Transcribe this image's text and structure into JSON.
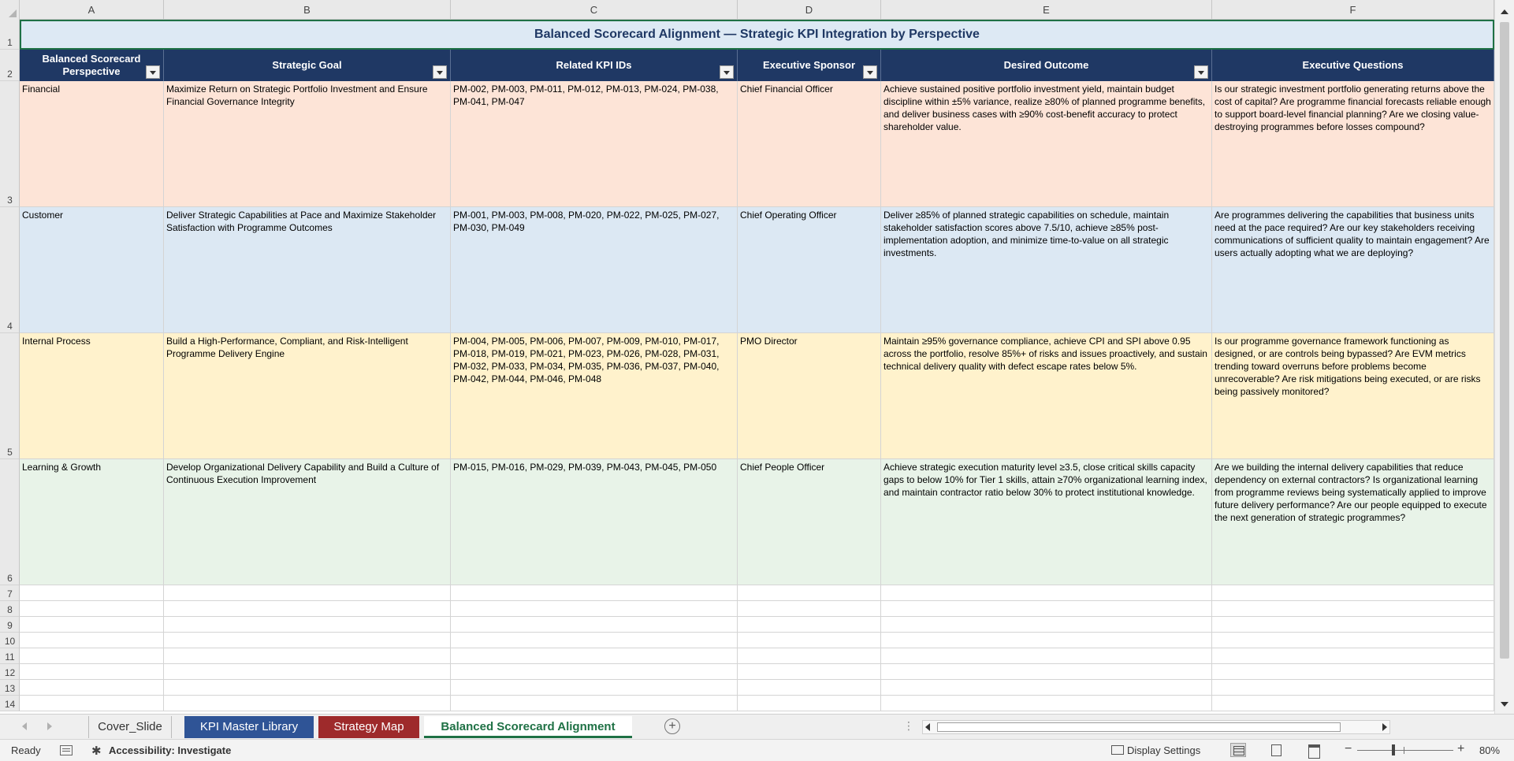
{
  "columns": [
    "A",
    "B",
    "C",
    "D",
    "E",
    "F"
  ],
  "rows": [
    "1",
    "2",
    "3",
    "4",
    "5",
    "6",
    "7",
    "8",
    "9",
    "10",
    "11",
    "12",
    "13",
    "14"
  ],
  "title": "Balanced Scorecard Alignment — Strategic KPI Integration by Perspective",
  "headers": [
    "Balanced Scorecard Perspective",
    "Strategic Goal",
    "Related KPI IDs",
    "Executive Sponsor",
    "Desired Outcome",
    "Executive Questions"
  ],
  "data": [
    {
      "perspective": "Financial",
      "goal": "Maximize Return on Strategic Portfolio Investment and Ensure Financial Governance Integrity",
      "kpis": "PM-002, PM-003, PM-011, PM-012, PM-013, PM-024, PM-038, PM-041, PM-047",
      "sponsor": "Chief Financial Officer",
      "outcome": "Achieve sustained positive portfolio investment yield, maintain budget discipline within ±5% variance, realize ≥80% of planned programme benefits, and deliver business cases with ≥90% cost-benefit accuracy to protect shareholder value.",
      "questions": "Is our strategic investment portfolio generating returns above the cost of capital? Are programme financial forecasts reliable enough to support board-level financial planning? Are we closing value-destroying programmes before losses compound?"
    },
    {
      "perspective": "Customer",
      "goal": "Deliver Strategic Capabilities at Pace and Maximize Stakeholder Satisfaction with Programme Outcomes",
      "kpis": "PM-001, PM-003, PM-008, PM-020, PM-022, PM-025, PM-027, PM-030, PM-049",
      "sponsor": "Chief Operating Officer",
      "outcome": "Deliver ≥85% of planned strategic capabilities on schedule, maintain stakeholder satisfaction scores above 7.5/10, achieve ≥85% post-implementation adoption, and minimize time-to-value on all strategic investments.",
      "questions": "Are programmes delivering the capabilities that business units need at the pace required? Are our key stakeholders receiving communications of sufficient quality to maintain engagement? Are users actually adopting what we are deploying?"
    },
    {
      "perspective": "Internal Process",
      "goal": "Build a High-Performance, Compliant, and Risk-Intelligent Programme Delivery Engine",
      "kpis": "PM-004, PM-005, PM-006, PM-007, PM-009, PM-010, PM-017, PM-018, PM-019, PM-021, PM-023, PM-026, PM-028, PM-031, PM-032, PM-033, PM-034, PM-035, PM-036, PM-037, PM-040, PM-042, PM-044, PM-046, PM-048",
      "sponsor": "PMO Director",
      "outcome": "Maintain ≥95% governance compliance, achieve CPI and SPI above 0.95 across the portfolio, resolve 85%+ of risks and issues proactively, and sustain technical delivery quality with defect escape rates below 5%.",
      "questions": "Is our programme governance framework functioning as designed, or are controls being bypassed? Are EVM metrics trending toward overruns before problems become unrecoverable? Are risk mitigations being executed, or are risks being passively monitored?"
    },
    {
      "perspective": "Learning & Growth",
      "goal": "Develop Organizational Delivery Capability and Build a Culture of Continuous Execution Improvement",
      "kpis": "PM-015, PM-016, PM-029, PM-039, PM-043, PM-045, PM-050",
      "sponsor": "Chief People Officer",
      "outcome": "Achieve strategic execution maturity level ≥3.5, close critical skills capacity gaps to below 10% for Tier 1 skills, attain ≥70% organizational learning index, and maintain contractor ratio below 30% to protect institutional knowledge.",
      "questions": "Are we building the internal delivery capabilities that reduce dependency on external contractors? Is organizational learning from programme reviews being systematically applied to improve future delivery performance? Are our people equipped to execute the next generation of strategic programmes?"
    }
  ],
  "tabs": [
    "Cover_Slide",
    "KPI Master Library",
    "Strategy Map",
    "Balanced Scorecard Alignment"
  ],
  "status": {
    "ready": "Ready",
    "accessibility": "Accessibility: Investigate",
    "display_settings": "Display Settings",
    "zoom": "80%"
  },
  "colors": {
    "header_fill": "#1f3864",
    "title_fill": "#dde9f4",
    "financial": "#fde4d7",
    "customer": "#dce8f3",
    "internal": "#fff2cc",
    "learning": "#e8f3e8",
    "tab_kpi": "#2f5496",
    "tab_strategy": "#9e2a2b",
    "active_tab_text": "#1f7145"
  },
  "icons": {
    "add_sheet": "+",
    "accessibility": "accessibility-icon",
    "display": "display-icon"
  }
}
